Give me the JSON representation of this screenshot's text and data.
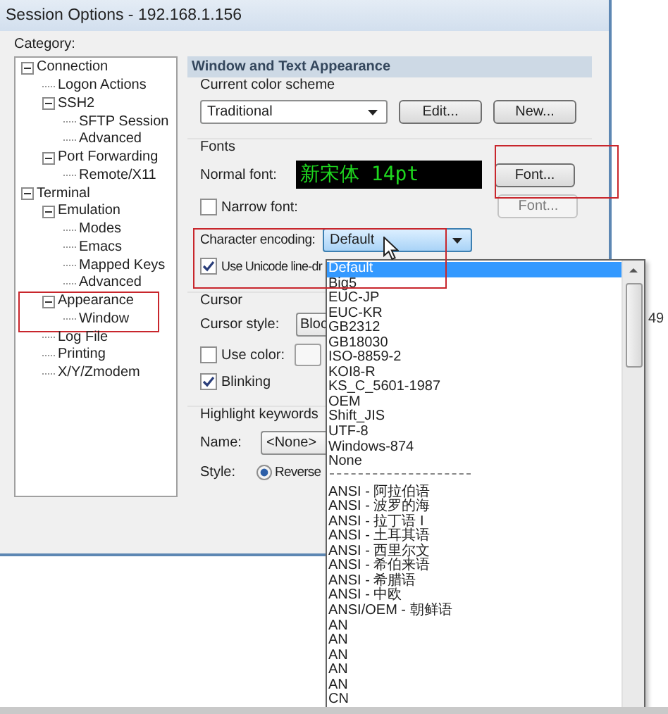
{
  "window": {
    "title": "Session Options - 192.168.1.156"
  },
  "category": {
    "label": "Category:",
    "tree": [
      {
        "label": "Connection",
        "expanded": true,
        "children": [
          {
            "label": "Logon Actions"
          },
          {
            "label": "SSH2",
            "expanded": true,
            "children": [
              {
                "label": "SFTP Session"
              },
              {
                "label": "Advanced"
              }
            ]
          },
          {
            "label": "Port Forwarding",
            "expanded": true,
            "children": [
              {
                "label": "Remote/X11"
              }
            ]
          }
        ]
      },
      {
        "label": "Terminal",
        "expanded": true,
        "children": [
          {
            "label": "Emulation",
            "expanded": true,
            "children": [
              {
                "label": "Modes"
              },
              {
                "label": "Emacs"
              },
              {
                "label": "Mapped Keys"
              },
              {
                "label": "Advanced"
              }
            ]
          },
          {
            "label": "Appearance",
            "expanded": true,
            "annotated": true,
            "children": [
              {
                "label": "Window"
              }
            ]
          },
          {
            "label": "Log File"
          },
          {
            "label": "Printing"
          },
          {
            "label": "X/Y/Zmodem"
          }
        ]
      }
    ]
  },
  "panel": {
    "title": "Window and Text Appearance",
    "color_scheme": {
      "label": "Current color scheme",
      "value": "Traditional",
      "buttons": [
        "Edit...",
        "New..."
      ]
    },
    "fonts": {
      "label": "Fonts",
      "normal_font_label": "Normal font:",
      "preview": "新宋体 14pt",
      "font_button": {
        "label": "Font...",
        "annotated": true
      },
      "narrow_font": {
        "label": "Narrow font:",
        "checked": false
      },
      "narrow_font_button": {
        "label": "Font...",
        "disabled": true
      },
      "encoding": {
        "label": "Character encoding:",
        "value": "Default",
        "annotated": true
      },
      "unicode_line_drawing": {
        "label": "Use Unicode line-dr",
        "checked": true
      }
    },
    "cursor": {
      "label": "Cursor",
      "style_label": "Cursor style:",
      "style_value": "Bloc",
      "use_color": {
        "label": "Use color:",
        "checked": false
      },
      "blinking": {
        "label": "Blinking",
        "checked": true
      }
    },
    "highlight": {
      "label": "Highlight keywords",
      "name_label": "Name:",
      "name_value": "<None>",
      "style_label": "Style:",
      "style_option": {
        "label": "Reverse",
        "selected": true
      }
    }
  },
  "encoding_list": [
    {
      "kind": "item",
      "label": "Default",
      "selected": true
    },
    {
      "kind": "item",
      "label": "Big5",
      "selected": false
    },
    {
      "kind": "item",
      "label": "EUC-JP",
      "selected": false
    },
    {
      "kind": "item",
      "label": "EUC-KR",
      "selected": false
    },
    {
      "kind": "item",
      "label": "GB2312",
      "selected": false
    },
    {
      "kind": "item",
      "label": "GB18030",
      "selected": false
    },
    {
      "kind": "item",
      "label": "ISO-8859-2",
      "selected": false
    },
    {
      "kind": "item",
      "label": "KOI8-R",
      "selected": false
    },
    {
      "kind": "item",
      "label": "KS_C_5601-1987",
      "selected": false
    },
    {
      "kind": "item",
      "label": "OEM",
      "selected": false
    },
    {
      "kind": "item",
      "label": "Shift_JIS",
      "selected": false
    },
    {
      "kind": "item",
      "label": "UTF-8",
      "selected": false
    },
    {
      "kind": "item",
      "label": "Windows-874",
      "selected": false
    },
    {
      "kind": "item",
      "label": "None",
      "selected": false
    },
    {
      "kind": "separator"
    },
    {
      "kind": "item",
      "label": "ANSI - 阿拉伯语",
      "selected": false
    },
    {
      "kind": "item",
      "label": "ANSI - 波罗的海",
      "selected": false
    },
    {
      "kind": "item",
      "label": "ANSI - 拉丁语 I",
      "selected": false
    },
    {
      "kind": "item",
      "label": "ANSI - 土耳其语",
      "selected": false
    },
    {
      "kind": "item",
      "label": "ANSI - 西里尔文",
      "selected": false
    },
    {
      "kind": "item",
      "label": "ANSI - 希伯来语",
      "selected": false
    },
    {
      "kind": "item",
      "label": "ANSI - 希腊语",
      "selected": false
    },
    {
      "kind": "item",
      "label": "ANSI - 中欧",
      "selected": false
    },
    {
      "kind": "item",
      "label": "ANSI/OEM - 朝鲜语",
      "selected": false
    },
    {
      "kind": "item",
      "label": "AN",
      "selected": false
    },
    {
      "kind": "item",
      "label": "AN",
      "selected": false
    },
    {
      "kind": "item",
      "label": "AN",
      "selected": false
    },
    {
      "kind": "item",
      "label": "AN",
      "selected": false
    },
    {
      "kind": "item",
      "label": "AN",
      "selected": false
    },
    {
      "kind": "item",
      "label": "CN",
      "selected": false
    }
  ],
  "background_text": "49"
}
